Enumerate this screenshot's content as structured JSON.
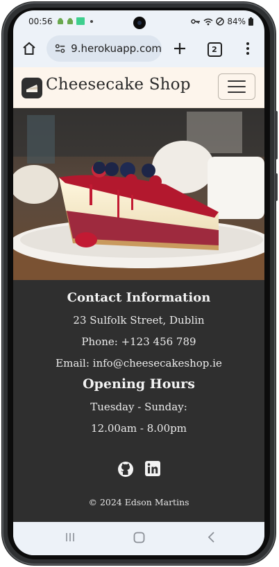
{
  "status_bar": {
    "time": "00:56",
    "battery": "84%"
  },
  "browser": {
    "url": "9.herokuapp.com",
    "tab_count": "2"
  },
  "site": {
    "brand": "Cheesecake Shop",
    "contact": {
      "heading": "Contact Information",
      "address": "23 Sulfolk Street, Dublin",
      "phone": "Phone: +123 456 789",
      "email": "Email: info@cheesecakeshop.ie"
    },
    "hours": {
      "heading": "Opening Hours",
      "days": "Tuesday - Sunday:",
      "times": "12.00am - 8.00pm"
    },
    "social_icons": [
      "github-icon",
      "linkedin-icon"
    ],
    "copyright": "© 2024 Edson Martins"
  },
  "colors": {
    "navbar_bg": "#fdf5ec",
    "footer_bg": "#2f2f2f",
    "browser_bg": "#edf2f8"
  }
}
